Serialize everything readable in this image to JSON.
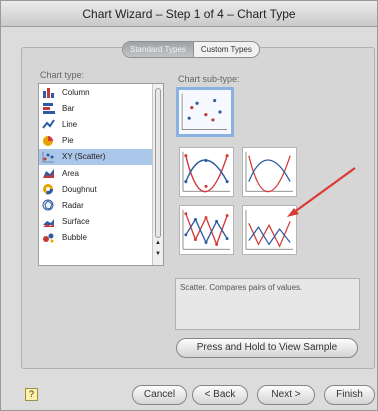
{
  "window": {
    "title": "Chart Wizard – Step 1 of 4 – Chart Type"
  },
  "tabs": [
    {
      "label": "Standard Types",
      "selected": true
    },
    {
      "label": "Custom Types",
      "selected": false
    }
  ],
  "labels": {
    "chart_type": "Chart type:",
    "chart_subtype": "Chart sub-type:"
  },
  "chart_types": [
    {
      "label": "Column",
      "icon": "column-chart-icon"
    },
    {
      "label": "Bar",
      "icon": "bar-chart-icon"
    },
    {
      "label": "Line",
      "icon": "line-chart-icon"
    },
    {
      "label": "Pie",
      "icon": "pie-chart-icon"
    },
    {
      "label": "XY (Scatter)",
      "icon": "scatter-chart-icon",
      "selected": true
    },
    {
      "label": "Area",
      "icon": "area-chart-icon"
    },
    {
      "label": "Doughnut",
      "icon": "doughnut-chart-icon"
    },
    {
      "label": "Radar",
      "icon": "radar-chart-icon"
    },
    {
      "label": "Surface",
      "icon": "surface-chart-icon"
    },
    {
      "label": "Bubble",
      "icon": "bubble-chart-icon"
    }
  ],
  "description": "Scatter. Compares pairs of values.",
  "buttons": {
    "sample": "Press and Hold to View Sample",
    "cancel": "Cancel",
    "back": "< Back",
    "next": "Next >",
    "finish": "Finish",
    "help": "?"
  },
  "colors": {
    "selection": "#aac6e8",
    "annotation_arrow": "#d93b35"
  }
}
